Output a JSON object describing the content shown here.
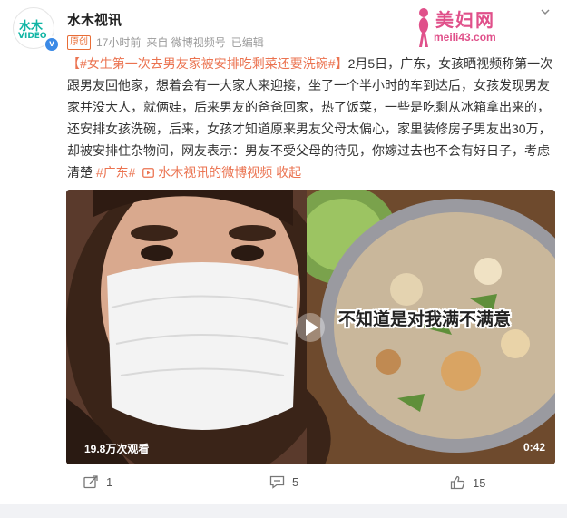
{
  "author": {
    "name": "水木视讯",
    "avatar_text_top": "水木",
    "avatar_text_bottom": "VIDEO",
    "verified_mark": "v"
  },
  "meta": {
    "original_badge": "原创",
    "time": "17小时前",
    "source": "来自 微博视频号",
    "edited": "已编辑"
  },
  "watermark": {
    "title": "美妇网",
    "url": "meili43.com"
  },
  "post": {
    "bracket_open": "【",
    "hashtag": "#女生第一次去男友家被安排吃剩菜还要洗碗#",
    "bracket_close": "】",
    "body": "2月5日，广东，女孩晒视频称第一次跟男友回他家，想着会有一大家人来迎接，坐了一个半小时的车到达后，女孩发现男友家并没大人，就俩娃，后来男友的爸爸回家，热了饭菜，一些是吃剩从冰箱拿出来的，还安排女孩洗碗，后来，女孩才知道原来男友父母太偏心，家里装修房子男友出30万，却被安排住杂物间，网友表示：男友不受父母的待见，你嫁过去也不会有好日子，考虑清楚 ",
    "tag_guangdong": "#广东#",
    "video_link": "水木视讯的微博视频",
    "collect": "收起"
  },
  "video": {
    "subtitle": "不知道是对我满不满意",
    "views": "19.8万次观看",
    "duration": "0:42"
  },
  "actions": {
    "repost_count": "1",
    "comment_count": "5",
    "like_count": "15"
  },
  "colors": {
    "link": "#eb7350",
    "brand_teal": "#12b5a5",
    "verified_blue": "#3b8ae6",
    "watermark_pink": "#e0508a"
  },
  "icons": [
    "verified-icon",
    "chevron-down-icon",
    "video-link-icon",
    "play-icon",
    "repost-icon",
    "comment-icon",
    "like-icon"
  ]
}
